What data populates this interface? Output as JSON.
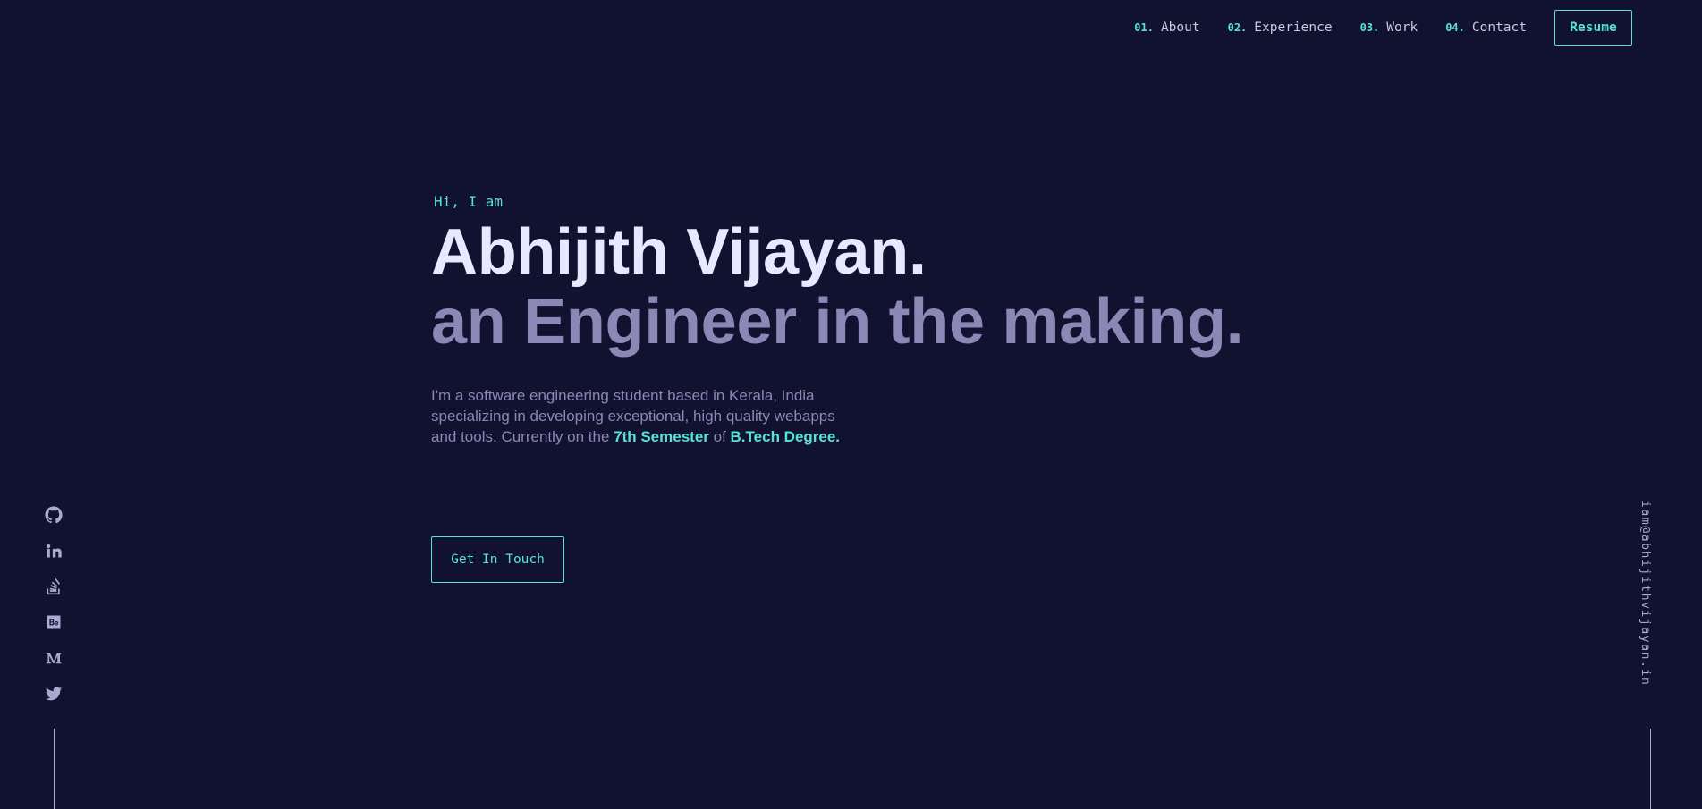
{
  "nav": {
    "items": [
      {
        "num": "01.",
        "label": "About"
      },
      {
        "num": "02.",
        "label": "Experience"
      },
      {
        "num": "03.",
        "label": "Work"
      },
      {
        "num": "04.",
        "label": "Contact"
      }
    ],
    "resume_label": "Resume"
  },
  "hero": {
    "greeting": "Hi, I am",
    "name": "Abhijith Vijayan.",
    "tagline": "an Engineer in the making.",
    "bio_start": "I'm a software engineering student based in Kerala, India specializing in developing exceptional, high quality webapps and tools. Currently on the ",
    "bio_hl1": "7th Semester",
    "bio_mid": " of ",
    "bio_hl2": "B.Tech Degree.",
    "cta_label": "Get In Touch"
  },
  "social": {
    "icons": [
      "github-icon",
      "linkedin-icon",
      "stackoverflow-icon",
      "behance-icon",
      "medium-icon",
      "twitter-icon"
    ]
  },
  "email": "iam@abhijithvijayan.in",
  "colors": {
    "background": "#111130",
    "accent": "#57e3d3",
    "heading": "#e6e9ff",
    "muted": "#8c87b5",
    "icon": "#a8abcf"
  }
}
